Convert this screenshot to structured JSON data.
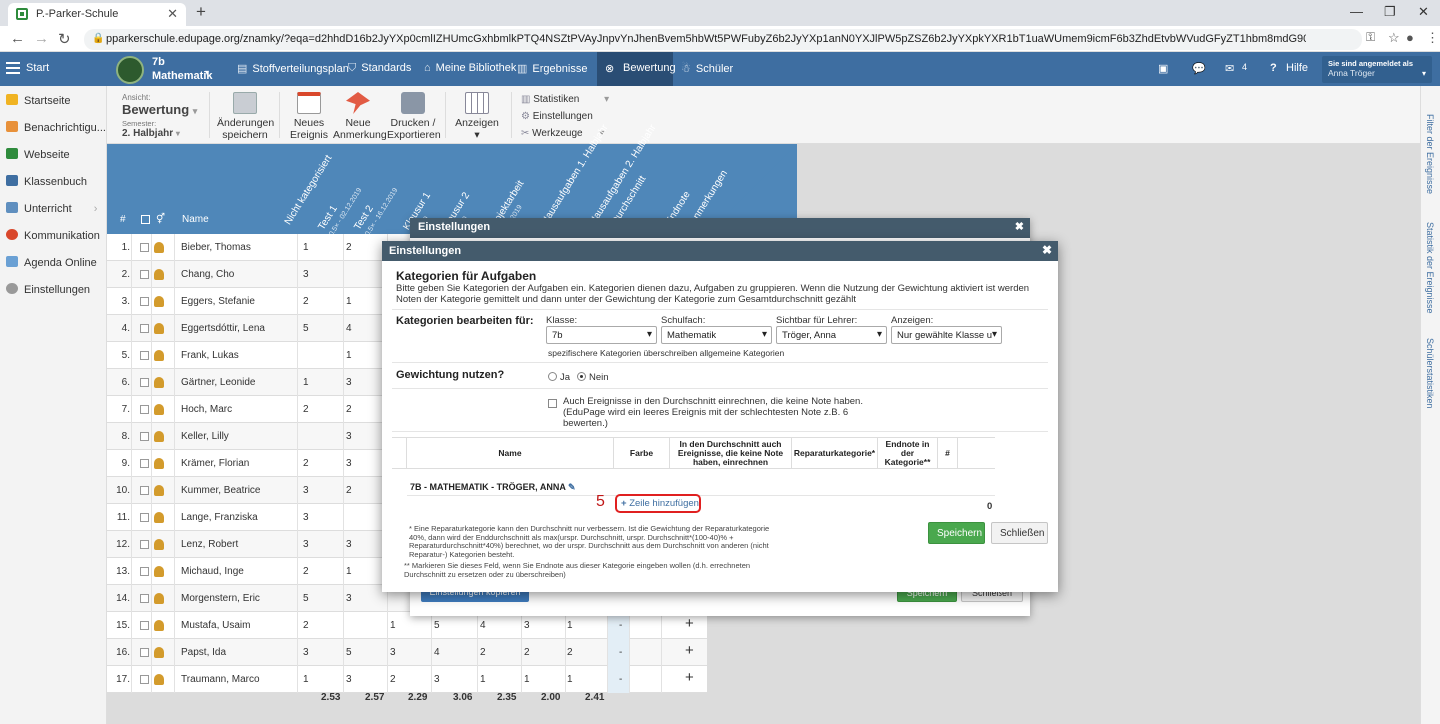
{
  "browser": {
    "tab_title": "P.-Parker-Schule",
    "url": "pparkerschule.edupage.org/znamky/?eqa=d2hhdD16b2JyYXp0cmlIZHUmcGxhbmlkPTQ4NSZtPVAyJnpvYnJhenBvem5hbWt5PWFubyZ6b2JyYXp1anN0YXJlPW5pZSZ6b2JyYXpkYXR1bT1uaWUmem9icmF6b3ZhdEtvbWVudGFyZT1hbm8mdG90YWxHcmFhZUVkaXQ9b..."
  },
  "app": {
    "start_label": "Start",
    "class_name": "7b",
    "subject": "Mathematik",
    "nav": [
      "Stoffverteilungsplan",
      "Standards",
      "Meine Bibliothek",
      "Ergebnisse",
      "Bewertung",
      "Schüler"
    ],
    "mail_count": "4",
    "help_label": "Hilfe",
    "logged_in_label": "Sie sind angemeldet als",
    "user_name": "Anna Tröger"
  },
  "sidebar": {
    "items": [
      "Startseite",
      "Benachrichtigu...",
      "Webseite",
      "Klassenbuch",
      "Unterricht",
      "Kommunikation",
      "Agenda Online",
      "Einstellungen"
    ]
  },
  "toolbar": {
    "view_label": "Ansicht:",
    "view_value": "Bewertung",
    "semester_label": "Semester:",
    "semester_value": "2. Halbjahr",
    "buttons": [
      {
        "line1": "Änderungen",
        "line2": "speichern"
      },
      {
        "line1": "Neues",
        "line2": "Ereignis"
      },
      {
        "line1": "Neue",
        "line2": "Anmerkung"
      },
      {
        "line1": "Drucken /",
        "line2": "Exportieren"
      },
      {
        "line1": "Anzeigen",
        "line2": ""
      }
    ],
    "menu": [
      "Statistiken",
      "Einstellungen",
      "Werkzeuge"
    ]
  },
  "grid": {
    "col_hash": "#",
    "col_name": "Name",
    "col_headers": [
      {
        "title": "Nicht kategorisiert",
        "sub": ""
      },
      {
        "title": "Test 1",
        "sub": "0.5× - 02.12.2019"
      },
      {
        "title": "Test 2",
        "sub": "0.5× - 16.12.2019"
      },
      {
        "title": "Klausur 1",
        "sub": "5.2019"
      },
      {
        "title": "Klausur 2",
        "sub": "1.2020"
      },
      {
        "title": "Projektarbeit",
        "sub": "17.12.2019"
      },
      {
        "title": "Hausaufgaben 1. Halbjahr",
        "sub": ""
      },
      {
        "title": "Hausaufgaben 2. Halbjahr",
        "sub": ""
      },
      {
        "title": "Durchschnitt",
        "sub": ""
      },
      {
        "title": "Endnote",
        "sub": ""
      },
      {
        "title": "Anmerkungen",
        "sub": ""
      }
    ],
    "students": [
      {
        "n": "1.",
        "name": "Bieber, Thomas",
        "g": [
          "1",
          "2",
          "",
          "",
          "",
          "",
          "",
          ""
        ]
      },
      {
        "n": "2.",
        "name": "Chang, Cho",
        "g": [
          "3",
          "",
          "",
          "",
          "",
          "",
          "",
          ""
        ]
      },
      {
        "n": "3.",
        "name": "Eggers, Stefanie",
        "g": [
          "2",
          "1",
          "",
          "",
          "",
          "",
          "",
          ""
        ]
      },
      {
        "n": "4.",
        "name": "Eggertsdóttir, Lena",
        "g": [
          "5",
          "4",
          "",
          "",
          "",
          "",
          "",
          ""
        ]
      },
      {
        "n": "5.",
        "name": "Frank, Lukas",
        "g": [
          "",
          "1",
          "",
          "",
          "",
          "",
          "",
          ""
        ]
      },
      {
        "n": "6.",
        "name": "Gärtner, Leonide",
        "g": [
          "1",
          "3",
          "",
          "",
          "",
          "",
          "",
          ""
        ]
      },
      {
        "n": "7.",
        "name": "Hoch, Marc",
        "g": [
          "2",
          "2",
          "",
          "",
          "",
          "",
          "",
          ""
        ]
      },
      {
        "n": "8.",
        "name": "Keller, Lilly",
        "g": [
          "",
          "3",
          "",
          "",
          "",
          "",
          "",
          ""
        ]
      },
      {
        "n": "9.",
        "name": "Krämer, Florian",
        "g": [
          "2",
          "3",
          "",
          "",
          "",
          "",
          "",
          ""
        ]
      },
      {
        "n": "10.",
        "name": "Kummer, Beatrice",
        "g": [
          "3",
          "2",
          "",
          "",
          "",
          "",
          "",
          ""
        ]
      },
      {
        "n": "11.",
        "name": "Lange, Franziska",
        "g": [
          "3",
          "",
          "",
          "",
          "",
          "",
          "",
          ""
        ]
      },
      {
        "n": "12.",
        "name": "Lenz, Robert",
        "g": [
          "3",
          "3",
          "",
          "",
          "",
          "",
          "",
          ""
        ]
      },
      {
        "n": "13.",
        "name": "Michaud, Inge",
        "g": [
          "2",
          "1",
          "",
          "",
          "",
          "",
          "",
          ""
        ]
      },
      {
        "n": "14.",
        "name": "Morgenstern, Eric",
        "g": [
          "5",
          "3",
          "",
          "",
          "",
          "",
          "",
          ""
        ]
      },
      {
        "n": "15.",
        "name": "Mustafa, Usaim",
        "g": [
          "2",
          "",
          "1",
          "5",
          "4",
          "3",
          "1",
          "-"
        ]
      },
      {
        "n": "16.",
        "name": "Papst, Ida",
        "g": [
          "3",
          "5",
          "3",
          "4",
          "2",
          "2",
          "2",
          "-"
        ]
      },
      {
        "n": "17.",
        "name": "Traumann, Marco",
        "g": [
          "1",
          "3",
          "2",
          "3",
          "1",
          "1",
          "1",
          "-"
        ]
      }
    ],
    "averages": [
      "2.53",
      "2.57",
      "2.29",
      "3.06",
      "2.35",
      "2.00",
      "2.41"
    ]
  },
  "rightrail": [
    "Filter der Ereignisse",
    "Statistik der Ereignisse",
    "Schülerstatistiken"
  ],
  "dialog_back": {
    "title": "Einstellungen",
    "btn_copy": "Einstellungen kopieren",
    "btn_save": "Speichern",
    "btn_close": "Schließen"
  },
  "dialog": {
    "title": "Einstellungen",
    "heading": "Kategorien für Aufgaben",
    "description": "Bitte geben Sie Kategorien der Aufgaben ein. Kategorien dienen dazu, Aufgaben zu gruppieren. Wenn die Nutzung der Gewichtung aktiviert ist werden Noten der Kategorie gemittelt und dann unter der Gewichtung der Kategorie zum Gesamtdurchschnitt gezählt",
    "edit_for_label": "Kategorien bearbeiten für:",
    "class_label": "Klasse:",
    "class_value": "7b",
    "subject_label": "Schulfach:",
    "subject_value": "Mathematik",
    "teacher_label": "Sichtbar für Lehrer:",
    "teacher_value": "Tröger, Anna",
    "show_label": "Anzeigen:",
    "show_value": "Nur gewählte Klasse u",
    "override_note": "spezifischere Kategorien überschreiben allgemeine Kategorien",
    "weighting_label": "Gewichtung nutzen?",
    "yes": "Ja",
    "no": "Nein",
    "include_check": "Auch Ereignisse in den Durchschnitt einrechnen, die keine Note haben. (EduPage wird ein leeres Ereignis mit der schlechtesten Note z.B. 6 bewerten.)",
    "table_headers": [
      "Name",
      "Farbe",
      "In den Durchschnitt auch Ereignisse, die keine Note haben, einrechnen",
      "Reparaturkategorie*",
      "Endnote in der Kategorie**",
      "#"
    ],
    "group_title": "7B - MATHEMATIK - TRÖGER, ANNA",
    "step_number": "5",
    "add_row": "Zeile hinzufügen",
    "count": "0",
    "note1": "* Eine Reparaturkategorie kann den Durchschnitt nur verbessern. Ist die Gewichtung der Reparaturkategorie 40%, dann wird der Enddurchschnitt als max(urspr. Durchschnitt, urspr. Durchschnitt*(100-40)% + Reparaturdurchschnitt*40%) berechnet, wo der urspr. Durchschnitt aus dem Durchschnitt von anderen (nicht Reparatur-) Kategorien besteht.",
    "note2": "** Markieren Sie dieses Feld, wenn Sie Endnote aus dieser Kategorie eingeben wollen (d.h. errechneten Durchschnitt zu ersetzen oder zu überschreiben)",
    "save": "Speichern",
    "close": "Schließen"
  }
}
